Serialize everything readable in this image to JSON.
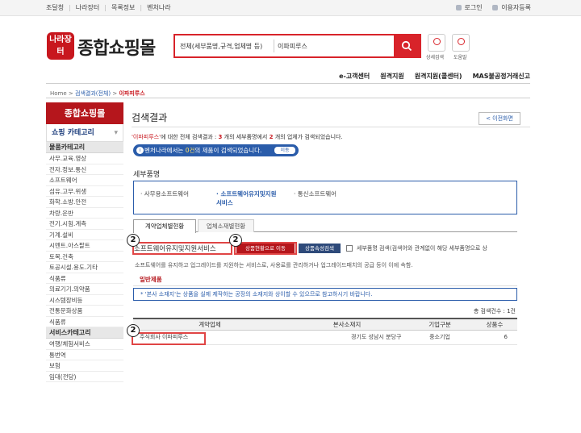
{
  "top_links": [
    "조달청",
    "나라장터",
    "목록정보",
    "벤처나라"
  ],
  "top_right": {
    "login": "로그인",
    "signup": "이용자등록"
  },
  "logo": {
    "seal_text": "나라장터",
    "name": "종합쇼핑몰"
  },
  "search": {
    "scope": "전체(세부품명,규격,업체명 등)",
    "value": "이파피루스"
  },
  "quick_buttons": [
    {
      "label": "상세검색"
    },
    {
      "label": "도움말"
    }
  ],
  "gnb": [
    "e-고객센터",
    "원격지원",
    "원격지원(콜센터)",
    "MAS불공정거래신고"
  ],
  "breadcrumb": {
    "home": "Home",
    "mid": "검색결과(전체)",
    "current": "이파피루스"
  },
  "sidebar": {
    "title": "종합쇼핑몰",
    "sub": "쇼핑 카테고리",
    "group1": "물품카테고리",
    "items1": [
      "사무.교육.영상",
      "전자.정보.통신",
      "소프트웨어",
      "섬유.고무.위생",
      "화학.소방.안전",
      "차량.운반",
      "전기.시험.계측",
      "기계.설비",
      "시멘트.아스팔트",
      "토목.건축",
      "토공시설.용도.기타",
      "식품류",
      "의료기기.의약품",
      "시스템장비등",
      "전통문화상품",
      "식품류"
    ],
    "group2": "서비스카테고리",
    "items2": [
      "여행/체험서비스",
      "통번역",
      "보험",
      "임대(전당)"
    ]
  },
  "main": {
    "title": "검색결과",
    "prev_button": "< 이전화면",
    "summary_kw": "'이파피루스'",
    "summary_mid": "에 대한 전체 검색결과 : ",
    "summary_n1": "3",
    "summary_mid2": "개의 세부품명에서",
    "summary_n2": "2",
    "summary_end": "개의 업체가 검색되었습니다.",
    "notice_pre": "벤처나라에서는",
    "notice_num": "0건",
    "notice_post": "의 제품이 검색되었습니다.",
    "notice_go": "이동",
    "section_title": "세부품명",
    "categories": [
      "사무용소프트웨어",
      "소프트웨어유지및지원\n서비스",
      "통신소프트웨어"
    ],
    "tabs": [
      "계약업체별현황",
      "업체소재별현황"
    ],
    "company_label": "소프트웨어유지및지원서비스",
    "status_button": "상품현황으로 이동",
    "attr_button": "상품속성검색",
    "check_label": "세부품명 검색(검색어와 관계없이 해당 세부품명으로 상",
    "desc": "소프트웨어를 유지하고 업그레이드를 지원하는 서비스로, 사용료를 관리하거나 업그레이드패치의 공급 등이 이에 속함.",
    "general": "일반제품",
    "note": "* '본사 소재지'는 상품을 실제 제작하는 공장의 소재지와 상이할 수 있으므로 참고하시기 바랍니다.",
    "count": "총 검색건수 : 1건",
    "table_headers": [
      "계약업체",
      "본사소재지",
      "기업구분",
      "상품수"
    ],
    "rows": [
      {
        "company": "주식회사 이파피루스",
        "location": "경기도 성남시 분당구",
        "type": "중소기업",
        "count": "6"
      }
    ]
  },
  "badges": [
    "2",
    "2",
    "2"
  ],
  "colors": {
    "brand_red": "#b5161c",
    "blue": "#2a5caa",
    "highlight": "#e04545"
  }
}
